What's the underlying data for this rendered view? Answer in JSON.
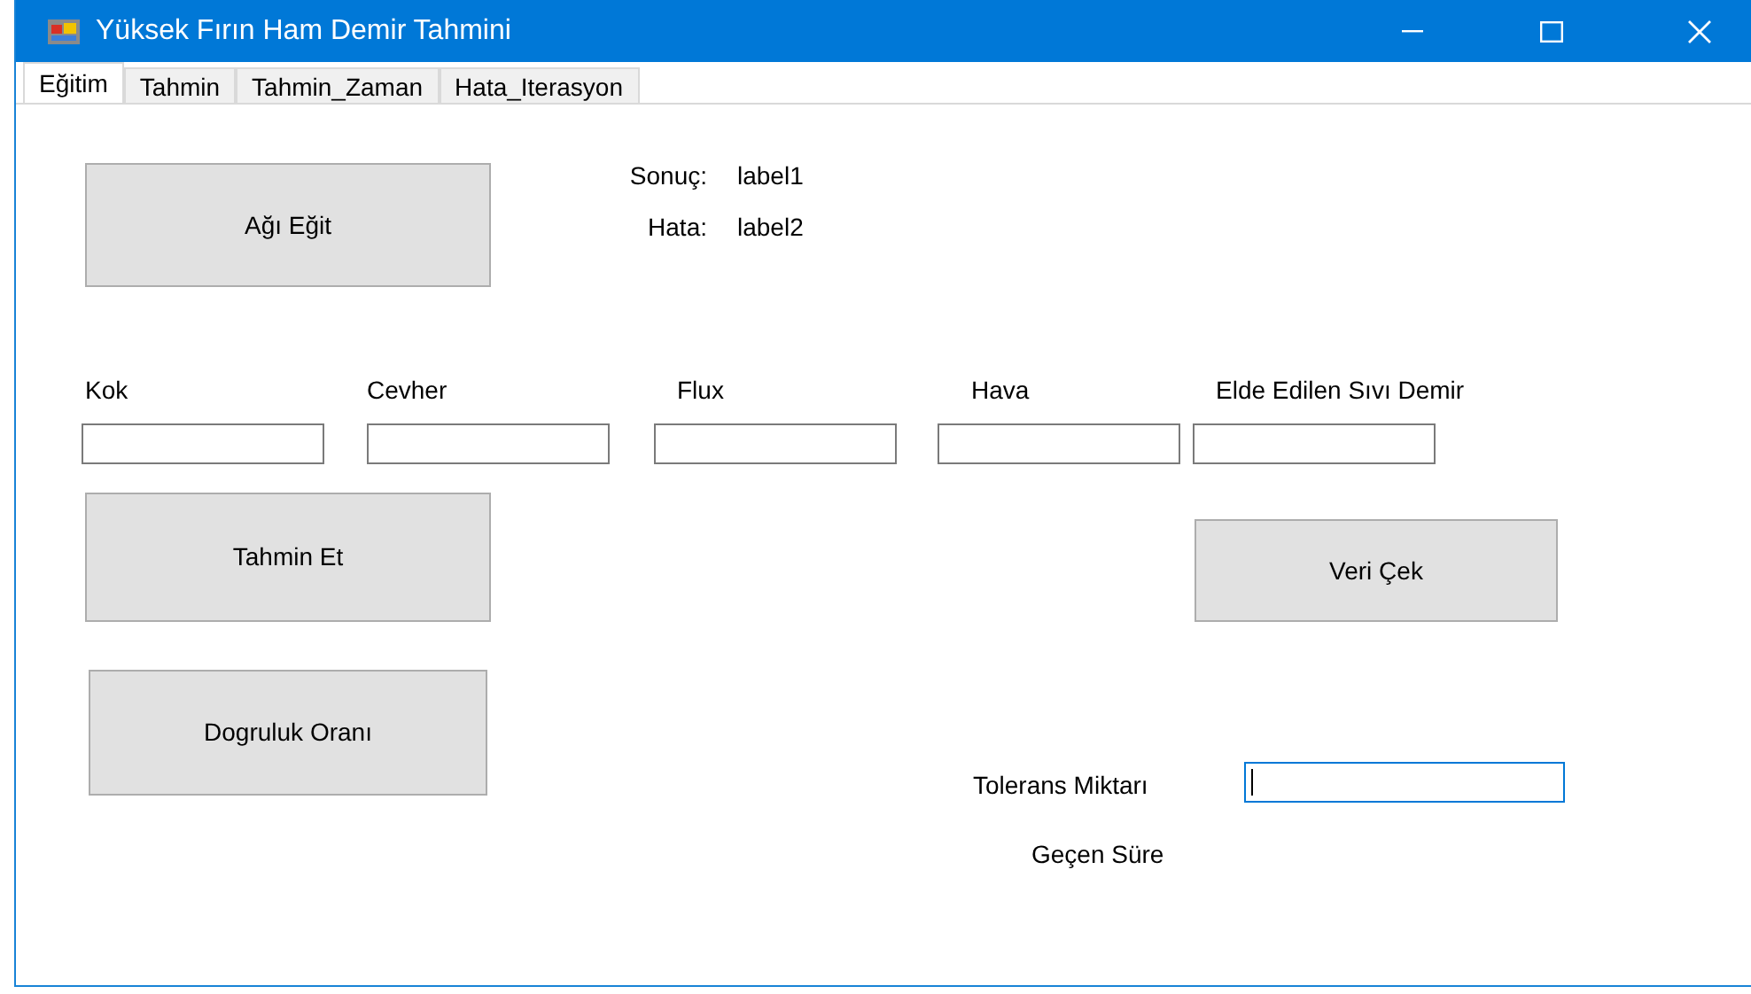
{
  "window": {
    "title": "Yüksek Fırın Ham Demir Tahmini"
  },
  "tabs": [
    {
      "label": "Eğitim",
      "selected": true
    },
    {
      "label": "Tahmin",
      "selected": false
    },
    {
      "label": "Tahmin_Zaman",
      "selected": false
    },
    {
      "label": "Hata_Iterasyon",
      "selected": false
    }
  ],
  "train_button": "Ağı Eğit",
  "results": [
    {
      "label": "Sonuç:",
      "value": "label1"
    },
    {
      "label": "Hata:",
      "value": "label2"
    }
  ],
  "inputs": [
    {
      "label": "Kok"
    },
    {
      "label": "Cevher"
    },
    {
      "label": "Flux"
    },
    {
      "label": "Hava"
    },
    {
      "label": "Elde Edilen Sıvı Demir"
    }
  ],
  "predict_button": "Tahmin Et",
  "fetch_button": "Veri Çek",
  "accuracy_button": "Dogruluk Oranı",
  "tolerance": {
    "label": "Tolerans Miktarı",
    "focused": true
  },
  "elapsed_label": "Geçen Süre"
}
